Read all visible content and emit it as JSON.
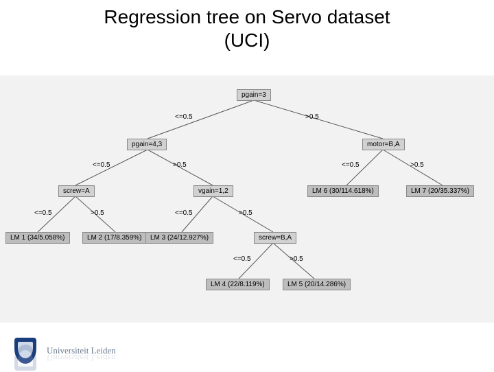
{
  "title_line1": "Regression tree on Servo dataset",
  "title_line2": "(UCI)",
  "left_label": "<=0.5",
  "right_label": ">0.5",
  "nodes": {
    "root": {
      "text": "pgain=3"
    },
    "n2": {
      "text": "pgain=4,3"
    },
    "n3": {
      "text": "motor=B,A"
    },
    "n4": {
      "text": "screw=A"
    },
    "n5": {
      "text": "vgain=1,2"
    },
    "lm6": {
      "text": "LM 6 (30/114.618%)"
    },
    "lm7": {
      "text": "LM 7 (20/35.337%)"
    },
    "lm1": {
      "text": "LM 1 (34/5.058%)"
    },
    "lm2": {
      "text": "LM 2 (17/8.359%)"
    },
    "lm3": {
      "text": "LM 3 (24/12.927%)"
    },
    "n6": {
      "text": "screw=B,A"
    },
    "lm4": {
      "text": "LM 4 (22/8.119%)"
    },
    "lm5": {
      "text": "LM 5 (20/14.286%)"
    }
  },
  "footer": "Universiteit Leiden"
}
